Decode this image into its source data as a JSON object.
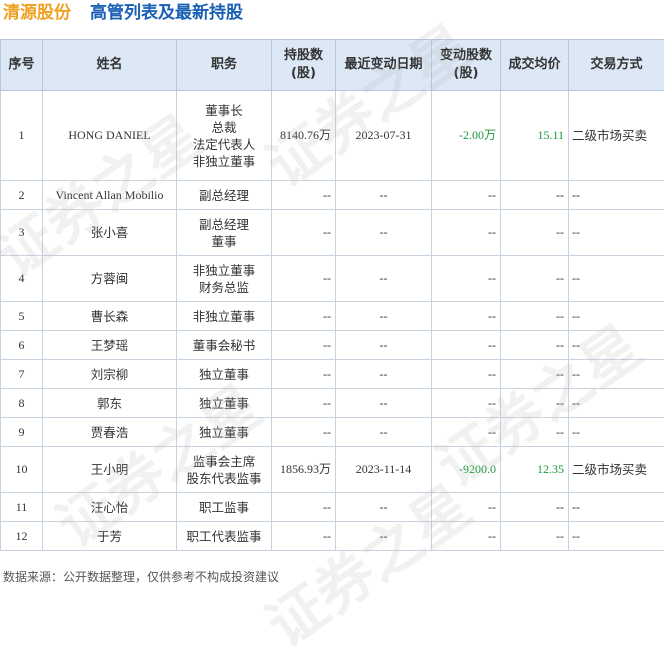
{
  "header": {
    "company": "清源股份",
    "subtitle": "高管列表及最新持股"
  },
  "table": {
    "columns": [
      "序号",
      "姓名",
      "职务",
      "持股数\n(股)",
      "最近变动日期",
      "变动股数\n(股)",
      "成交均价",
      "交易方式"
    ],
    "rows": [
      {
        "no": "1",
        "name": "HONG DANIEL",
        "positions": [
          "董事长",
          "总裁",
          "法定代表人",
          "非独立董事"
        ],
        "shares": "8140.76万",
        "date": "2023-07-31",
        "change": "-2.00万",
        "price": "15.11",
        "method": "二级市场买卖"
      },
      {
        "no": "2",
        "name": "Vincent Allan Mobilio",
        "positions": [
          "副总经理"
        ],
        "shares": "--",
        "date": "--",
        "change": "--",
        "price": "--",
        "method": "--"
      },
      {
        "no": "3",
        "name": "张小喜",
        "positions": [
          "副总经理",
          "董事"
        ],
        "shares": "--",
        "date": "--",
        "change": "--",
        "price": "--",
        "method": "--"
      },
      {
        "no": "4",
        "name": "方蓉闽",
        "positions": [
          "非独立董事",
          "财务总监"
        ],
        "shares": "--",
        "date": "--",
        "change": "--",
        "price": "--",
        "method": "--"
      },
      {
        "no": "5",
        "name": "曹长森",
        "positions": [
          "非独立董事"
        ],
        "shares": "--",
        "date": "--",
        "change": "--",
        "price": "--",
        "method": "--"
      },
      {
        "no": "6",
        "name": "王梦瑶",
        "positions": [
          "董事会秘书"
        ],
        "shares": "--",
        "date": "--",
        "change": "--",
        "price": "--",
        "method": "--"
      },
      {
        "no": "7",
        "name": "刘宗柳",
        "positions": [
          "独立董事"
        ],
        "shares": "--",
        "date": "--",
        "change": "--",
        "price": "--",
        "method": "--"
      },
      {
        "no": "8",
        "name": "郭东",
        "positions": [
          "独立董事"
        ],
        "shares": "--",
        "date": "--",
        "change": "--",
        "price": "--",
        "method": "--"
      },
      {
        "no": "9",
        "name": "贾春浩",
        "positions": [
          "独立董事"
        ],
        "shares": "--",
        "date": "--",
        "change": "--",
        "price": "--",
        "method": "--"
      },
      {
        "no": "10",
        "name": "王小明",
        "positions": [
          "监事会主席",
          "股东代表监事"
        ],
        "shares": "1856.93万",
        "date": "2023-11-14",
        "change": "-9200.0",
        "price": "12.35",
        "method": "二级市场买卖"
      },
      {
        "no": "11",
        "name": "汪心怡",
        "positions": [
          "职工监事"
        ],
        "shares": "--",
        "date": "--",
        "change": "--",
        "price": "--",
        "method": "--"
      },
      {
        "no": "12",
        "name": "于芳",
        "positions": [
          "职工代表监事"
        ],
        "shares": "--",
        "date": "--",
        "change": "--",
        "price": "--",
        "method": "--"
      }
    ]
  },
  "watermark": "证券之星",
  "footer": "数据来源：公开数据整理，仅供参考不构成投资建议"
}
